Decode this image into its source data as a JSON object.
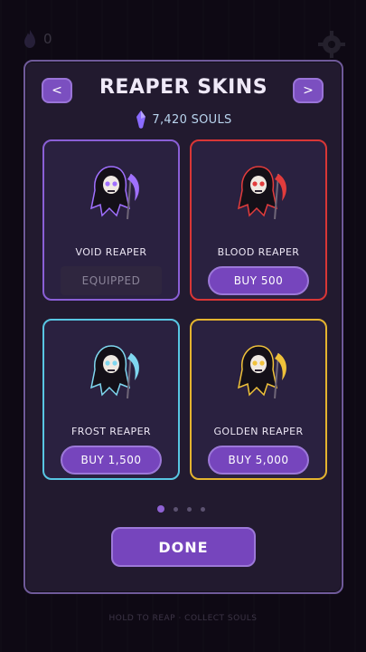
{
  "hud": {
    "souls_count": "0",
    "soul_icon": "soul-flame-icon",
    "settings_icon": "gear-icon"
  },
  "modal": {
    "title": "REAPER SKINS",
    "prev_label": "<",
    "next_label": ">",
    "souls": "7,420 SOULS",
    "soul_icon_color": "#8a6bff",
    "skins": [
      {
        "name": "VOID REAPER",
        "action": "EQUIPPED",
        "border": "#8a5fd6",
        "accent": "#a070ff",
        "state": "equipped"
      },
      {
        "name": "BLOOD REAPER",
        "action": "BUY  500",
        "border": "#d93636",
        "accent": "#e23c3c",
        "state": "buy"
      },
      {
        "name": "FROST REAPER",
        "action": "BUY  1,500",
        "border": "#58c6e3",
        "accent": "#7fd7f0",
        "state": "buy"
      },
      {
        "name": "GOLDEN REAPER",
        "action": "BUY  5,000",
        "border": "#e4b42f",
        "accent": "#f0c23a",
        "state": "buy"
      }
    ],
    "page_count": 4,
    "active_page": 1,
    "done_label": "DONE"
  },
  "footer": {
    "text": "HOLD TO REAP · COLLECT SOULS"
  }
}
